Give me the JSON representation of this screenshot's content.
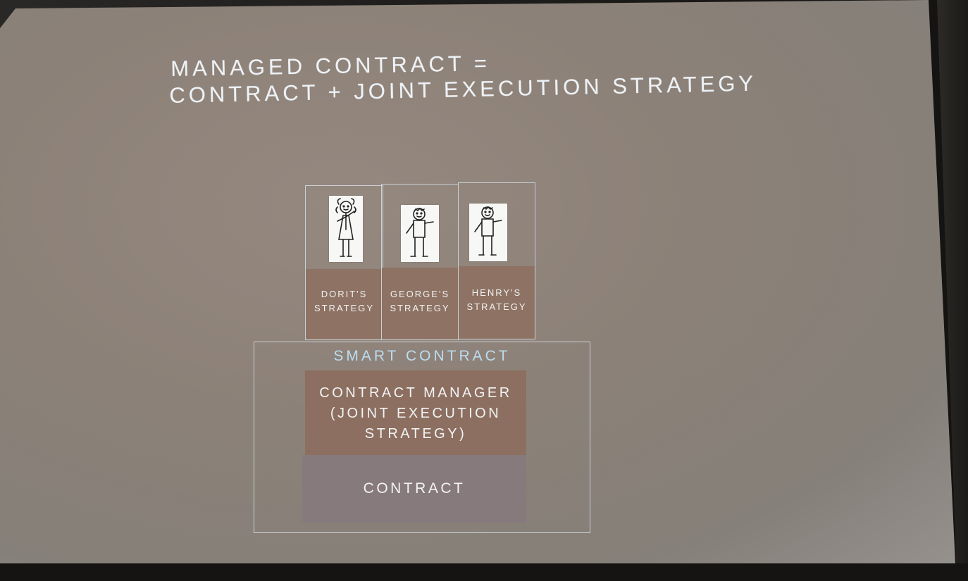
{
  "slide": {
    "title_line1": "MANAGED CONTRACT =",
    "title_line2": "CONTRACT + JOINT EXECUTION STRATEGY"
  },
  "strategies": [
    {
      "line1": "DORIT'S",
      "line2": "STRATEGY",
      "icon": "girl-stick-figure-icon"
    },
    {
      "line1": "GEORGE'S",
      "line2": "STRATEGY",
      "icon": "boy-stick-figure-icon"
    },
    {
      "line1": "HENRY'S",
      "line2": "STRATEGY",
      "icon": "boy-stick-figure-icon"
    }
  ],
  "smart_contract": {
    "title": "SMART CONTRACT",
    "manager_line1": "CONTRACT MANAGER",
    "manager_line2": "(JOINT EXECUTION",
    "manager_line3": "STRATEGY)",
    "contract_label": "CONTRACT"
  },
  "colors": {
    "title_text": "#eef2f6",
    "smart_contract_title": "#bcdcf0",
    "strategy_fill": "#8e7263",
    "manager_fill": "#8c6f60",
    "contract_fill": "#867a7d",
    "box_border": "#c9d0d6"
  }
}
